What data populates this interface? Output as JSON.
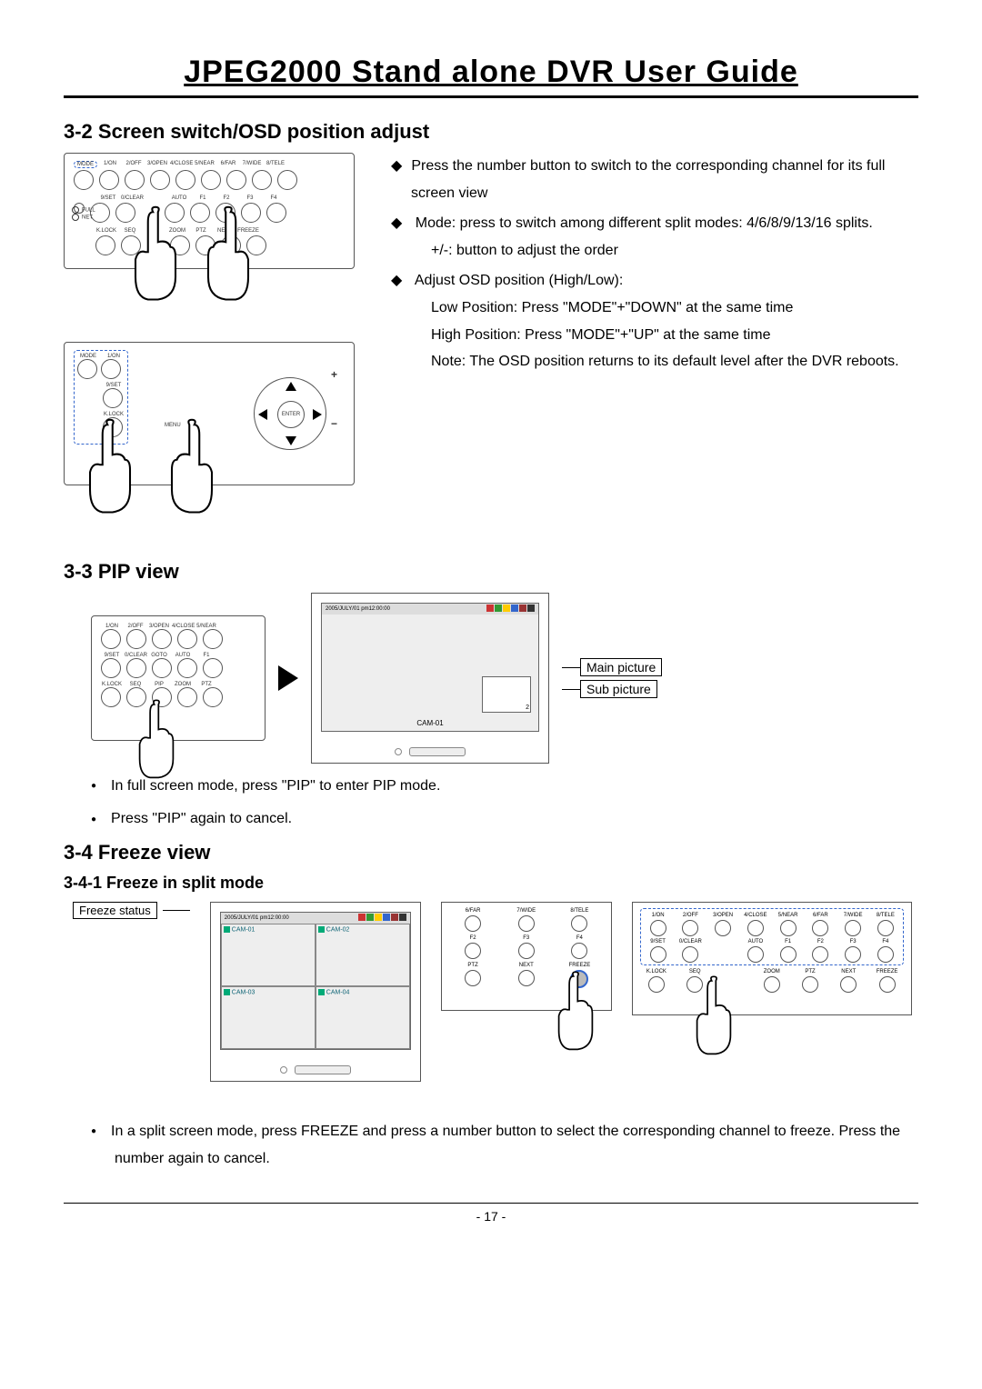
{
  "doc_title": "JPEG2000  Stand  alone  DVR  User  Guide",
  "section_3_2": {
    "heading": "3-2 Screen switch/OSD position adjust",
    "bullets": [
      "Press the number button to switch to the corresponding channel for its full screen view",
      "Mode: press to switch among different split modes: 4/6/8/9/13/16 splits.",
      "Adjust OSD position (High/Low):"
    ],
    "plus_minus_line": "+/-: button to adjust the order",
    "osd_lines": [
      "Low Position: Press \"MODE\"+\"DOWN\" at the same time",
      "High Position: Press \"MODE\"+\"UP\" at the same time",
      "Note: The OSD position returns to its default level after the DVR reboots."
    ],
    "remote_top_row": [
      "MODE",
      "1/ON",
      "2/OFF",
      "3/OPEN",
      "4/CLOSE",
      "5/NEAR",
      "6/FAR",
      "7/WIDE",
      "8/TELE"
    ],
    "remote_mid_row": [
      "",
      "9/SET",
      "0/CLEAR",
      "",
      "AUTO",
      "F1",
      "F2",
      "F3",
      "F4"
    ],
    "remote_bottom_row": [
      "K.LOCK",
      "SEQ",
      "",
      "ZOOM",
      "PTZ",
      "NEXT",
      "FREEZE"
    ],
    "remote_side": [
      "FULL",
      "NET"
    ],
    "remote2_labels": [
      "MODE",
      "1/ON",
      "9/SET",
      "K.LOCK",
      "MENU",
      "ENTER"
    ]
  },
  "section_3_3": {
    "heading": "3-3 PIP view",
    "timestamp": "2005/JULY/01 pm12:00:00",
    "cam_label": "CAM-01",
    "subpic_num": "2",
    "main_picture_label": "Main picture",
    "sub_picture_label": "Sub picture",
    "remote_labels_top": [
      "1/ON",
      "2/OFF",
      "3/OPEN",
      "4/CLOSE",
      "5/NEAR"
    ],
    "remote_labels_mid": [
      "9/SET",
      "0/CLEAR",
      "GOTO",
      "AUTO",
      "F1"
    ],
    "remote_labels_bot": [
      "K.LOCK",
      "SEQ",
      "PIP",
      "ZOOM",
      "PTZ"
    ],
    "bullets": [
      "In full screen mode, press \"PIP\" to enter PIP mode.",
      "Press \"PIP\" again to cancel."
    ]
  },
  "section_3_4": {
    "heading": "3-4 Freeze view",
    "sub_heading": "3-4-1 Freeze in split mode",
    "timestamp": "2005/JULY/01 pm12:00:00",
    "freeze_status_label": "Freeze status",
    "quad_labels": [
      "CAM-01",
      "CAM-02",
      "CAM-03",
      "CAM-04"
    ],
    "remote_a_top": [
      "6/FAR",
      "7/WIDE",
      "8/TELE"
    ],
    "remote_a_mid": [
      "F2",
      "F3",
      "F4"
    ],
    "remote_a_bot": [
      "PTZ",
      "NEXT",
      "FREEZE"
    ],
    "remote_b_top": [
      "1/ON",
      "2/OFF",
      "3/OPEN",
      "4/CLOSE",
      "5/NEAR",
      "6/FAR",
      "7/WIDE",
      "8/TELE"
    ],
    "remote_b_mid": [
      "9/SET",
      "0/CLEAR",
      "",
      "AUTO",
      "F1",
      "F2",
      "F3",
      "F4"
    ],
    "remote_b_bot": [
      "K.LOCK",
      "SEQ",
      "",
      "ZOOM",
      "PTZ",
      "NEXT",
      "FREEZE"
    ],
    "bullets": [
      "In a split screen mode, press FREEZE and press a number button to select the corresponding channel to freeze. Press the number again to cancel."
    ]
  },
  "page_number": "- 17 -"
}
